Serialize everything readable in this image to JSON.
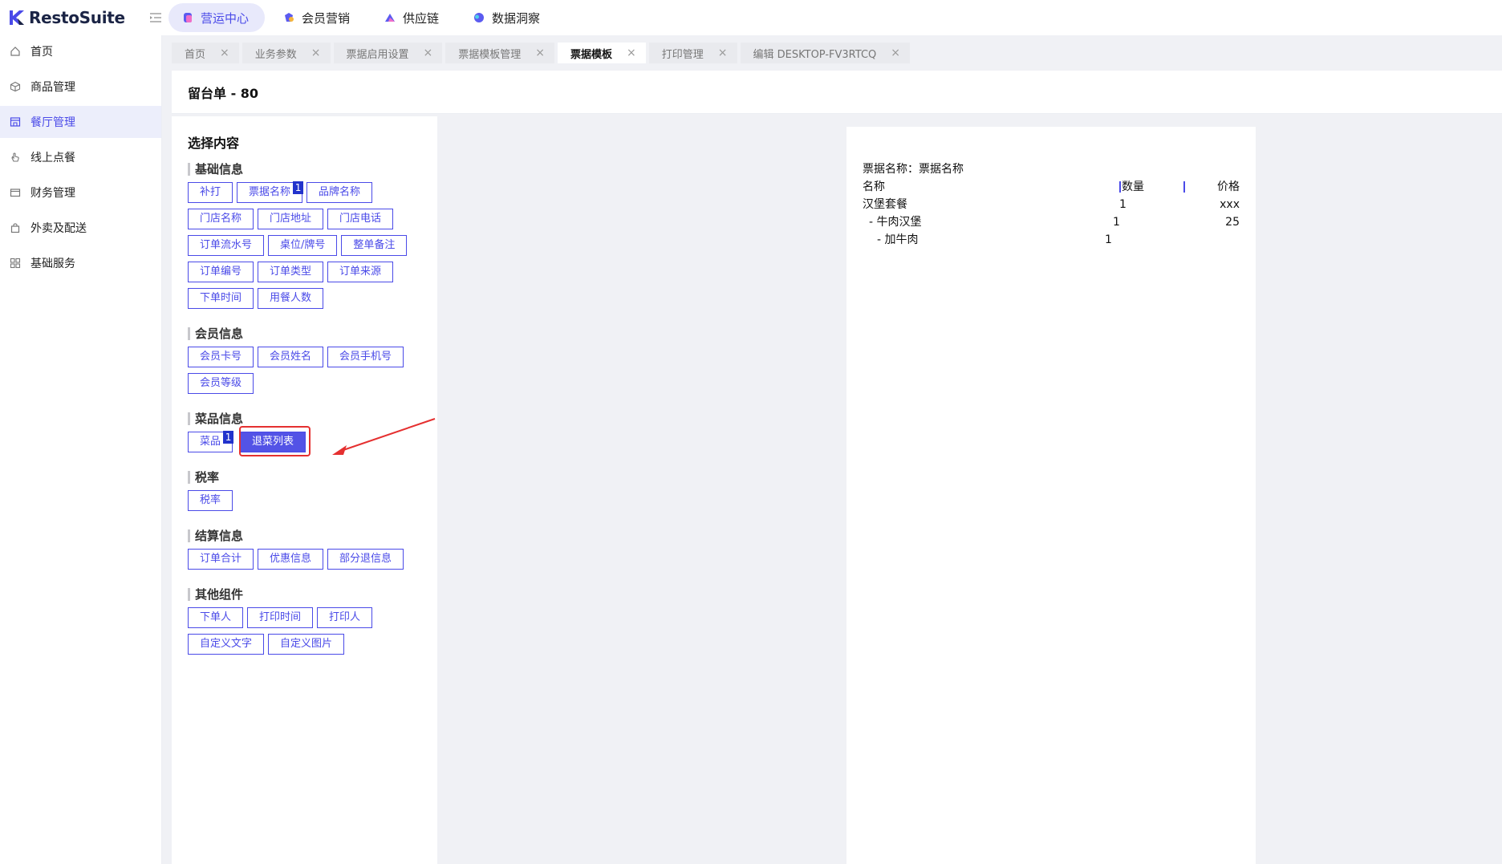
{
  "brand": {
    "name": "RestoSuite"
  },
  "top_nav": [
    {
      "label": "营运中心",
      "active": true
    },
    {
      "label": "会员营销",
      "active": false
    },
    {
      "label": "供应链",
      "active": false
    },
    {
      "label": "数据洞察",
      "active": false
    }
  ],
  "sidebar": {
    "items": [
      {
        "label": "首页",
        "icon": "home-icon"
      },
      {
        "label": "商品管理",
        "icon": "box-icon"
      },
      {
        "label": "餐厅管理",
        "icon": "store-icon",
        "active": true
      },
      {
        "label": "线上点餐",
        "icon": "hand-icon"
      },
      {
        "label": "财务管理",
        "icon": "wallet-icon"
      },
      {
        "label": "外卖及配送",
        "icon": "bag-icon"
      },
      {
        "label": "基础服务",
        "icon": "grid-icon"
      }
    ]
  },
  "tabs": [
    {
      "label": "首页"
    },
    {
      "label": "业务参数"
    },
    {
      "label": "票据启用设置"
    },
    {
      "label": "票据模板管理"
    },
    {
      "label": "票据模板",
      "active": true
    },
    {
      "label": "打印管理"
    },
    {
      "label": "编辑 DESKTOP-FV3RTCQ"
    }
  ],
  "header": {
    "title": "留台单 - 80"
  },
  "panel": {
    "title": "选择内容",
    "sections": [
      {
        "title": "基础信息",
        "chips": [
          {
            "label": "补打"
          },
          {
            "label": "票据名称",
            "badge": "1"
          },
          {
            "label": "品牌名称"
          },
          {
            "label": "门店名称"
          },
          {
            "label": "门店地址"
          },
          {
            "label": "门店电话"
          },
          {
            "label": "订单流水号"
          },
          {
            "label": "桌位/牌号"
          },
          {
            "label": "整单备注"
          },
          {
            "label": "订单编号"
          },
          {
            "label": "订单类型"
          },
          {
            "label": "订单来源"
          },
          {
            "label": "下单时间"
          },
          {
            "label": "用餐人数"
          }
        ]
      },
      {
        "title": "会员信息",
        "chips": [
          {
            "label": "会员卡号"
          },
          {
            "label": "会员姓名"
          },
          {
            "label": "会员手机号"
          },
          {
            "label": "会员等级"
          }
        ]
      },
      {
        "title": "菜品信息",
        "chips": [
          {
            "label": "菜品",
            "badge": "1"
          },
          {
            "label": "退菜列表",
            "filled": true
          }
        ]
      },
      {
        "title": "税率",
        "chips": [
          {
            "label": "税率"
          }
        ]
      },
      {
        "title": "结算信息",
        "chips": [
          {
            "label": "订单合计"
          },
          {
            "label": "优惠信息"
          },
          {
            "label": "部分退信息"
          }
        ]
      },
      {
        "title": "其他组件",
        "chips": [
          {
            "label": "下单人"
          },
          {
            "label": "打印时间"
          },
          {
            "label": "打印人"
          },
          {
            "label": "自定义文字"
          },
          {
            "label": "自定义图片"
          }
        ]
      }
    ]
  },
  "receipt": {
    "title_line": "票据名称：票据名称",
    "headers": {
      "name": "名称",
      "qty": "数量",
      "price": "价格"
    },
    "rows": [
      {
        "name": "汉堡套餐",
        "qty": "1",
        "price": "xxx"
      },
      {
        "name": "- 牛肉汉堡",
        "qty": "1",
        "price": "25",
        "indent": 1
      },
      {
        "name": "- 加牛肉",
        "qty": "1",
        "price": "",
        "indent": 2
      }
    ]
  },
  "colors": {
    "accent": "#4a4ae8",
    "annotation": "#e53030"
  }
}
